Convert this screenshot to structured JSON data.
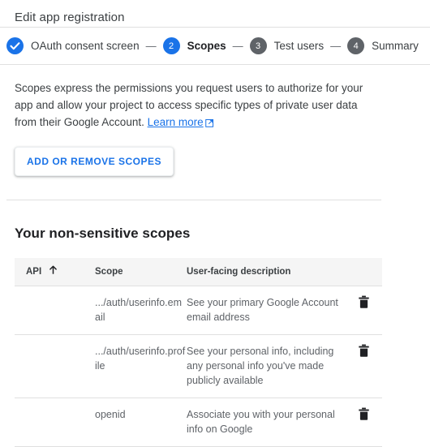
{
  "dialog": {
    "title": "Edit app registration"
  },
  "stepper": {
    "connector": "—",
    "steps": [
      {
        "number": "1",
        "label": "OAuth consent screen",
        "state": "done",
        "icon": "check-icon"
      },
      {
        "number": "2",
        "label": "Scopes",
        "state": "active"
      },
      {
        "number": "3",
        "label": "Test users",
        "state": "todo"
      },
      {
        "number": "4",
        "label": "Summary",
        "state": "todo"
      }
    ]
  },
  "intro": {
    "text": "Scopes express the permissions you request users to authorize for your app and allow your project to access specific types of private user data from their Google Account. ",
    "link_label": "Learn more",
    "link_icon": "external-link-icon"
  },
  "actions": {
    "add_remove_scopes_label": "ADD OR REMOVE SCOPES"
  },
  "section": {
    "title": "Your non-sensitive scopes"
  },
  "table": {
    "columns": {
      "api": "API",
      "scope": "Scope",
      "description": "User-facing description",
      "sort_icon": "sort-ascending-arrow-icon"
    },
    "rows": [
      {
        "api": "",
        "scope": ".../auth/userinfo.email",
        "description": "See your primary Google Account email address",
        "delete_icon": "delete-icon"
      },
      {
        "api": "",
        "scope": ".../auth/userinfo.profile",
        "description": "See your personal info, including any personal info you've made publicly available",
        "delete_icon": "delete-icon"
      },
      {
        "api": "",
        "scope": "openid",
        "description": "Associate you with your personal info on Google",
        "delete_icon": "delete-icon"
      }
    ]
  },
  "colors": {
    "accent_blue": "#1a73e8",
    "step_inactive_gray": "#5f6368",
    "divider": "#e0e0e0",
    "table_header_bg": "#f5f5f5",
    "text_primary": "#3c4043",
    "text_secondary": "#5f6368"
  }
}
